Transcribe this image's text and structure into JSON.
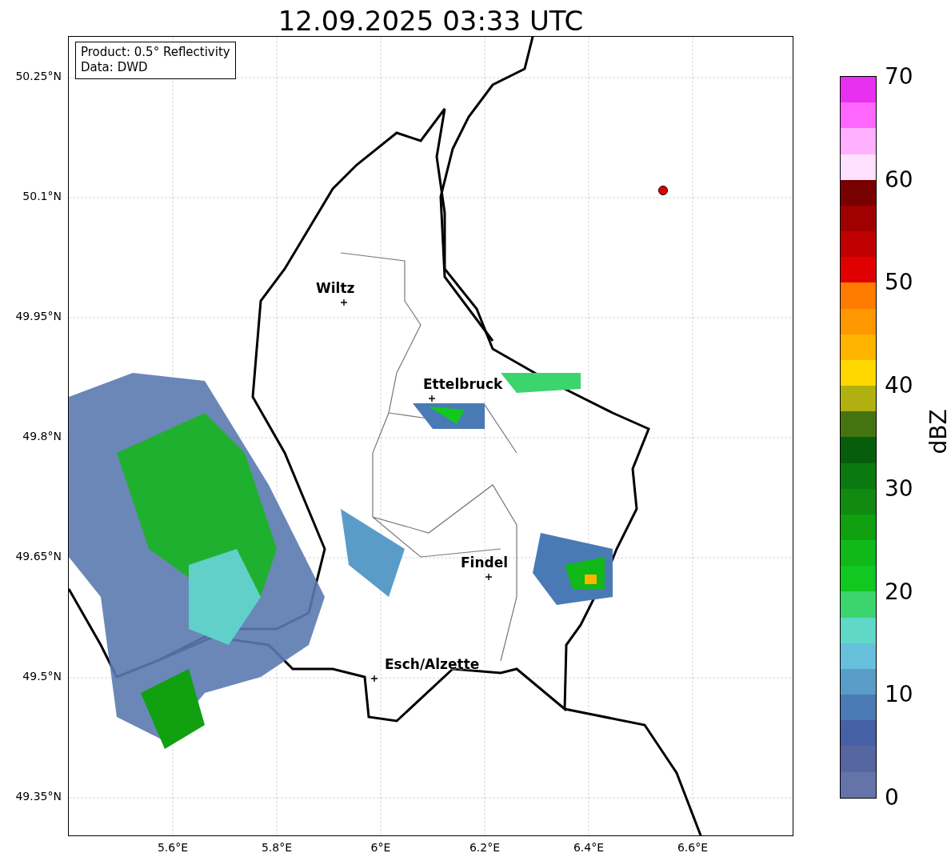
{
  "title": "12.09.2025 03:33 UTC",
  "info_box": [
    "Product: 0.5° Reflectivity",
    "Data: DWD"
  ],
  "map": {
    "x_ticks": [
      "5.6°E",
      "5.8°E",
      "6°E",
      "6.2°E",
      "6.4°E",
      "6.6°E"
    ],
    "y_ticks": [
      "50.25°N",
      "50.1°N",
      "49.95°N",
      "49.8°N",
      "49.65°N",
      "49.5°N",
      "49.35°N"
    ],
    "places": [
      {
        "name": "Wiltz"
      },
      {
        "name": "Ettelbruck"
      },
      {
        "name": "Findel"
      },
      {
        "name": "Esch/Alzette"
      }
    ]
  },
  "colorbar": {
    "label": "dBZ",
    "ticks": [
      "70",
      "60",
      "50",
      "40",
      "30",
      "20",
      "10",
      "0"
    ],
    "steps": [
      {
        "color": "#e830f0"
      },
      {
        "color": "#ff66ff"
      },
      {
        "color": "#ffb0ff"
      },
      {
        "color": "#ffe0ff"
      },
      {
        "color": "#780000"
      },
      {
        "color": "#a00000"
      },
      {
        "color": "#c00000"
      },
      {
        "color": "#e00000"
      },
      {
        "color": "#ff7c00"
      },
      {
        "color": "#ff9800"
      },
      {
        "color": "#ffb400"
      },
      {
        "color": "#ffd800"
      },
      {
        "color": "#b0b010"
      },
      {
        "color": "#447410"
      },
      {
        "color": "#065e0c"
      },
      {
        "color": "#0a7a10"
      },
      {
        "color": "#108a10"
      },
      {
        "color": "#10a010"
      },
      {
        "color": "#10b818"
      },
      {
        "color": "#10c820"
      },
      {
        "color": "#3cd46c"
      },
      {
        "color": "#60d8c8"
      },
      {
        "color": "#66c0dc"
      },
      {
        "color": "#5a9cc8"
      },
      {
        "color": "#4a7ab5"
      },
      {
        "color": "#4560a4"
      },
      {
        "color": "#5566a0"
      },
      {
        "color": "#6474a8"
      }
    ]
  }
}
